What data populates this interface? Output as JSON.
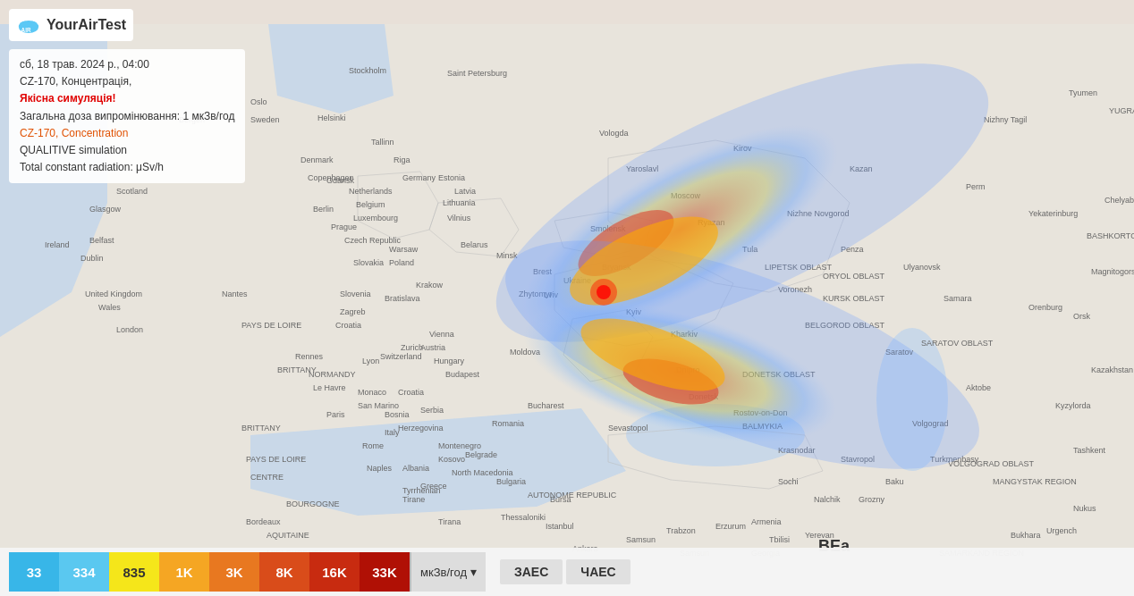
{
  "logo": {
    "text": "YourAirTest",
    "icon_alt": "cloud-icon"
  },
  "info_panel": {
    "line1": "сб, 18 трав. 2024 р., 04:00",
    "line2": "CZ-170, Концентрація,",
    "line3": "Якісна симуляція!",
    "line4": "Загальна доза випромінювання: 1 мкЗв/год",
    "line5": "CZ-170, Concentration",
    "line6": "QUALITIVE simulation",
    "line7": "Total constant radiation: μSv/h"
  },
  "scale": {
    "items": [
      {
        "label": "33",
        "class": "scale-33"
      },
      {
        "label": "334",
        "class": "scale-334"
      },
      {
        "label": "835",
        "class": "scale-835"
      },
      {
        "label": "1K",
        "class": "scale-1k"
      },
      {
        "label": "3K",
        "class": "scale-3k"
      },
      {
        "label": "8K",
        "class": "scale-8k"
      },
      {
        "label": "16K",
        "class": "scale-16k"
      },
      {
        "label": "33K",
        "class": "scale-33k"
      }
    ],
    "unit": "мкЗв/год",
    "dropdown_icon": "▾"
  },
  "buttons": {
    "zaes": "ЗАЕС",
    "chaes": "ЧАЕС"
  },
  "map": {
    "background_color": "#d4cfc8"
  }
}
